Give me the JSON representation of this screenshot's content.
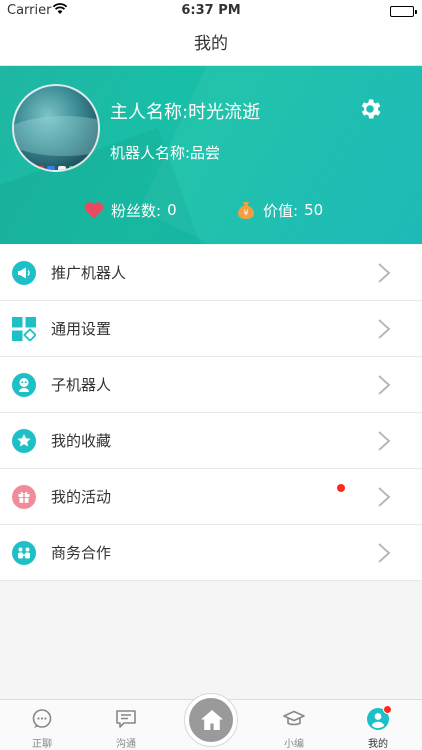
{
  "status_bar": {
    "carrier": "Carrier",
    "time": "6:37 PM"
  },
  "nav": {
    "title": "我的"
  },
  "profile": {
    "owner_label": "主人名称:时光流逝",
    "robot_label": "机器人名称:品尝",
    "fans_label": "粉丝数:",
    "fans_count": "0",
    "value_label": "价值:",
    "value_amount": "50",
    "settings_icon": "gear-icon",
    "colors": {
      "gradient_start": "#1fb6a2",
      "gradient_end": "#12b7b5",
      "heart": "#e84a5f",
      "money_bag": "#f0a040"
    }
  },
  "menu": {
    "items": [
      {
        "label": "推广机器人",
        "icon": "megaphone-icon",
        "color": "#1ec0c7"
      },
      {
        "label": "通用设置",
        "icon": "grid-settings-icon",
        "color": "#1ec0c7"
      },
      {
        "label": "子机器人",
        "icon": "robot-icon",
        "color": "#1ec0c7"
      },
      {
        "label": "我的收藏",
        "icon": "star-icon",
        "color": "#1ec0c7"
      },
      {
        "label": "我的活动",
        "icon": "gift-icon",
        "color": "#f08b9a",
        "has_dot": true
      },
      {
        "label": "商务合作",
        "icon": "handshake-icon",
        "color": "#1ec0c7"
      }
    ]
  },
  "tabbar": {
    "tabs": [
      {
        "label": "正聊",
        "icon": "chat-bubble-icon"
      },
      {
        "label": "沟通",
        "icon": "message-icon"
      },
      {
        "label": "",
        "icon": "home-icon"
      },
      {
        "label": "小编",
        "icon": "graduation-cap-icon"
      },
      {
        "label": "我的",
        "icon": "user-icon",
        "active": true,
        "has_badge": true
      }
    ]
  }
}
